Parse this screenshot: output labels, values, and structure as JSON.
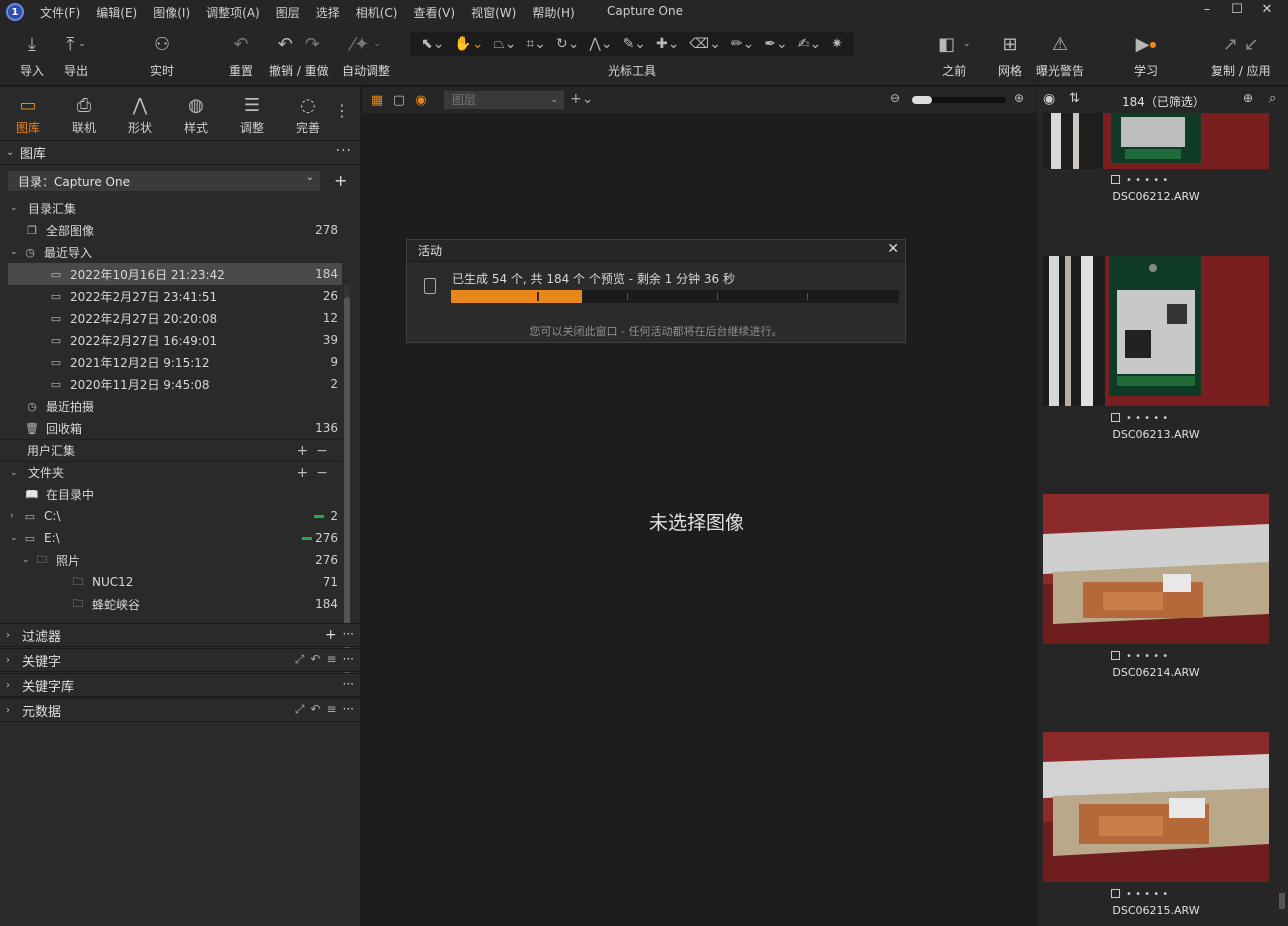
{
  "menubar": {
    "items": [
      "文件(F)",
      "编辑(E)",
      "图像(I)",
      "调整项(A)",
      "图层",
      "选择",
      "相机(C)",
      "查看(V)",
      "视窗(W)",
      "帮助(H)"
    ],
    "title": "Capture One",
    "min": "–",
    "max": "☐",
    "close": "✕"
  },
  "toolbar": {
    "import": "导入",
    "export": "导出",
    "live": "实时",
    "reset": "重置",
    "undo_redo": "撤销 / 重做",
    "auto_adjust": "自动调整",
    "cursor_tools": "光标工具",
    "before": "之前",
    "grid": "网格",
    "exposure_warning": "曝光警告",
    "learn": "学习",
    "copy_apply": "复制 / 应用"
  },
  "left_tabs": [
    "图库",
    "联机",
    "形状",
    "样式",
    "调整",
    "完善"
  ],
  "library": {
    "title": "图库",
    "catalog_label": "目录：Capture One",
    "catalog_collections": "目录汇集",
    "all_images": {
      "label": "全部图像",
      "count": "278"
    },
    "recent_imports": "最近导入",
    "imports": [
      {
        "label": "2022年10月16日 21:23:42",
        "count": "184",
        "selected": true
      },
      {
        "label": "2022年2月27日 23:41:51",
        "count": "26"
      },
      {
        "label": "2022年2月27日 20:20:08",
        "count": "12"
      },
      {
        "label": "2022年2月27日 16:49:01",
        "count": "39"
      },
      {
        "label": "2021年12月2日 9:15:12",
        "count": "9"
      },
      {
        "label": "2020年11月2日 9:45:08",
        "count": "2"
      }
    ],
    "recent_captures": "最近拍摄",
    "trash": {
      "label": "回收箱",
      "count": "136"
    },
    "user_collections": "用户汇集",
    "folders": "文件夹",
    "in_catalog": "在目录中",
    "drive_c": {
      "label": "C:\\",
      "count": "2"
    },
    "drive_e": {
      "label": "E:\\",
      "count": "276"
    },
    "photos": {
      "label": "照片",
      "count": "276"
    },
    "nuc12": {
      "label": "NUC12",
      "count": "71"
    },
    "canyon": {
      "label": "蜂蛇峡谷",
      "count": "184"
    }
  },
  "collapsed_sections": [
    "过滤器",
    "关键字",
    "关键字库",
    "元数据"
  ],
  "viewer": {
    "layer_placeholder": "图层",
    "no_image": "未选择图像"
  },
  "activity": {
    "title": "活动",
    "message": "已生成 54 个, 共 184 个 个预览 - 剩余 1 分钟 36 秒",
    "progress": 0.293,
    "note": "您可以关闭此窗口 - 任何活动都将在后台继续进行。"
  },
  "browser": {
    "count_label": "184（已筛选）",
    "thumbnails": [
      {
        "name": "DSC06212.ARW",
        "dots": "• • • • •"
      },
      {
        "name": "DSC06213.ARW",
        "dots": "• • • • •"
      },
      {
        "name": "DSC06214.ARW",
        "dots": "• • • • •"
      },
      {
        "name": "DSC06215.ARW",
        "dots": "• • • • •"
      }
    ]
  },
  "colors": {
    "accent": "#e8861a",
    "panel": "#2a2a2a",
    "viewer": "#1d1d1d",
    "selected_row": "#4a4a4a",
    "green": "#2aa64a"
  }
}
